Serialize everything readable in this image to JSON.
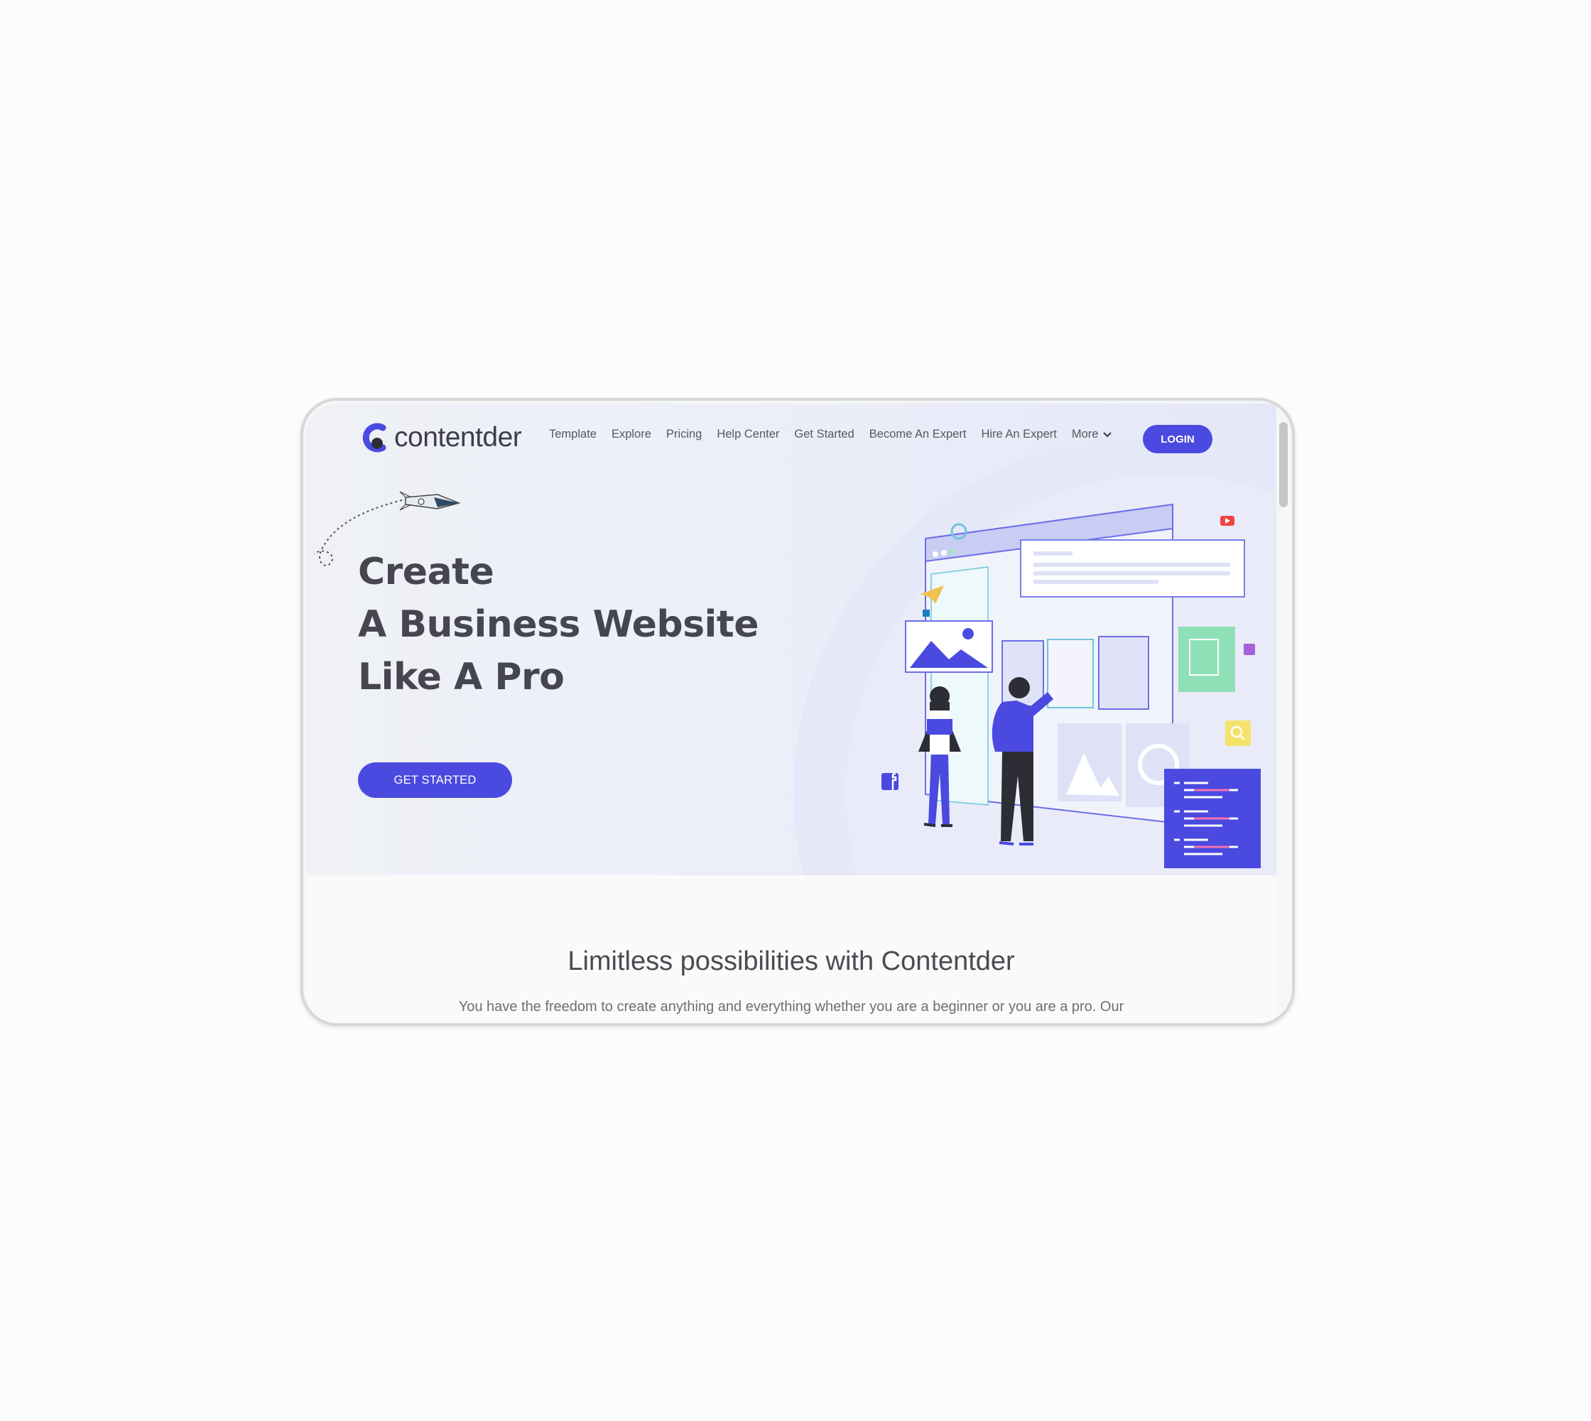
{
  "brand": {
    "name": "contentder",
    "accent": "#4a4ae0"
  },
  "nav": {
    "links": [
      "Template",
      "Explore",
      "Pricing",
      "Help Center",
      "Get Started",
      "Become An Expert",
      "Hire An Expert"
    ],
    "more_label": "More",
    "login_label": "LOGIN"
  },
  "hero": {
    "line1": "Create",
    "line2": "A Business Website",
    "line3": "Like A Pro",
    "cta_label": "GET STARTED",
    "illustration": "website-builder-illustration"
  },
  "section": {
    "title": "Limitless possibilities with Contentder",
    "text": "You have the freedom to create anything and everything whether you are a beginner or you are a pro. Our"
  },
  "icons": [
    "chevron-down-icon",
    "rocket-icon",
    "youtube-icon",
    "facebook-icon",
    "linkedin-icon",
    "search-icon",
    "lock-icon"
  ]
}
